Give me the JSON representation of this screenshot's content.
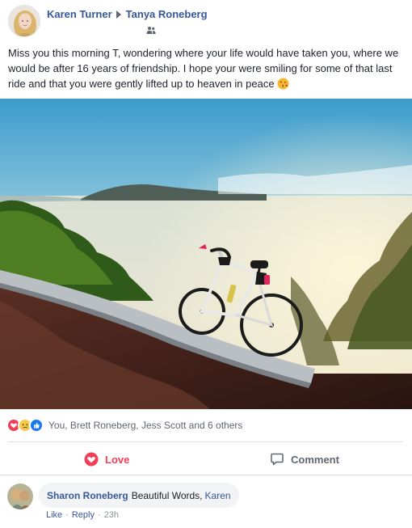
{
  "post": {
    "author": "Karen Turner",
    "recipient": "Tanya Roneberg",
    "audience_icon": "friends-icon",
    "text": "Miss you this morning T, wondering where your life would have taken you, where we would be after 16 years of friendship. I hope your were smiling for some of that last ride and that you were gently lifted up to heaven in peace",
    "text_emoji": "kiss-emoji",
    "photo_description": "bicycle-on-mountain-road-above-clouds"
  },
  "reactions": {
    "icons": [
      "love-reaction-icon",
      "sad-reaction-icon",
      "like-reaction-icon"
    ],
    "summary": "You, Brett Roneberg, Jess Scott and 6 others"
  },
  "actions": {
    "love_label": "Love",
    "comment_label": "Comment",
    "love_color": "#f33e58"
  },
  "comment": {
    "author": "Sharon Roneberg",
    "text": "Beautiful Words,",
    "mention": "Karen",
    "like_label": "Like",
    "reply_label": "Reply",
    "time": "23h"
  },
  "colors": {
    "link_blue": "#365899",
    "meta_gray": "#90949c"
  }
}
